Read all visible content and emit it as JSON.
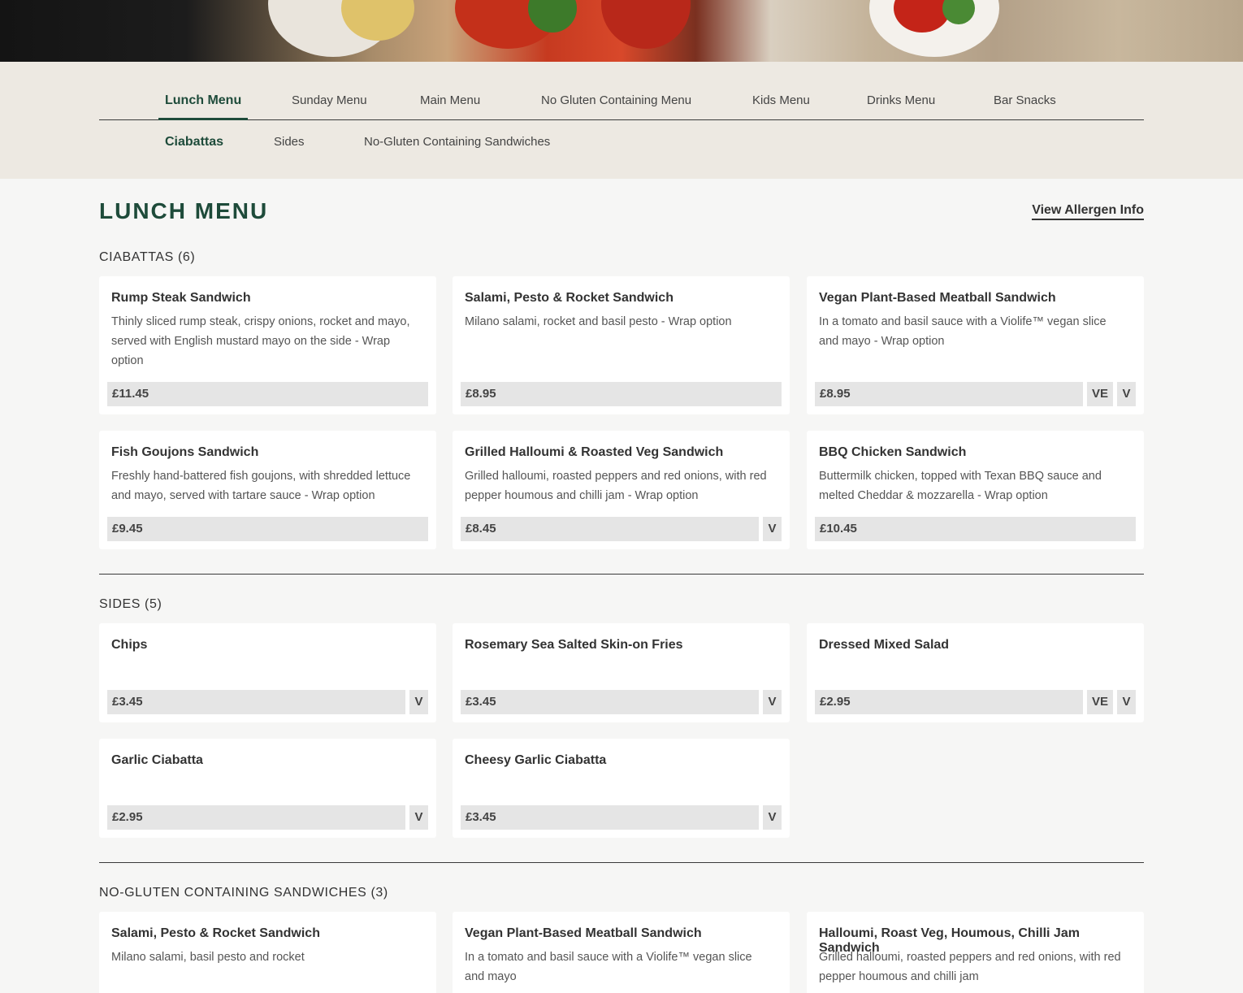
{
  "nav": {
    "tabs": [
      "Lunch Menu",
      "Sunday Menu",
      "Main Menu",
      "No Gluten Containing Menu",
      "Kids Menu",
      "Drinks Menu",
      "Bar Snacks"
    ],
    "subtabs": [
      "Ciabattas",
      "Sides",
      "No-Gluten Containing Sandwiches"
    ]
  },
  "page": {
    "title": "LUNCH MENU",
    "allergen_link": "View Allergen Info"
  },
  "colors": {
    "brand": "#1e4b3a",
    "price_bg": "#e5e5e5",
    "band_bg": "#ede9e2"
  },
  "sections": [
    {
      "title": "CIABATTAS (6)",
      "items": [
        {
          "name": "Rump Steak Sandwich",
          "desc": "Thinly sliced rump steak, crispy onions, rocket and mayo, served with English mustard mayo on the side - Wrap option",
          "price": "£11.45",
          "badges": []
        },
        {
          "name": "Salami, Pesto & Rocket Sandwich",
          "desc": "Milano salami, rocket and basil pesto - Wrap option",
          "price": "£8.95",
          "badges": []
        },
        {
          "name": "Vegan Plant-Based Meatball Sandwich",
          "desc": "In a tomato and basil sauce with a Violife™ vegan slice and mayo - Wrap option",
          "price": "£8.95",
          "badges": [
            "VE",
            "V"
          ]
        },
        {
          "name": "Fish Goujons Sandwich",
          "desc": "Freshly hand-battered fish goujons, with shredded lettuce and mayo, served with tartare sauce - Wrap option",
          "price": "£9.45",
          "badges": []
        },
        {
          "name": "Grilled Halloumi & Roasted Veg Sandwich",
          "desc": "Grilled halloumi, roasted peppers and red onions, with red pepper houmous and chilli jam - Wrap option",
          "price": "£8.45",
          "badges": [
            "V"
          ]
        },
        {
          "name": "BBQ Chicken Sandwich",
          "desc": "Buttermilk chicken, topped with Texan BBQ sauce and melted Cheddar & mozzarella - Wrap option",
          "price": "£10.45",
          "badges": []
        }
      ]
    },
    {
      "title": "SIDES (5)",
      "items": [
        {
          "name": "Chips",
          "desc": "",
          "price": "£3.45",
          "badges": [
            "V"
          ]
        },
        {
          "name": "Rosemary Sea Salted Skin-on Fries",
          "desc": "",
          "price": "£3.45",
          "badges": [
            "V"
          ]
        },
        {
          "name": "Dressed Mixed Salad",
          "desc": "",
          "price": "£2.95",
          "badges": [
            "VE",
            "V"
          ]
        },
        {
          "name": "Garlic Ciabatta",
          "desc": "",
          "price": "£2.95",
          "badges": [
            "V"
          ]
        },
        {
          "name": "Cheesy Garlic Ciabatta",
          "desc": "",
          "price": "£3.45",
          "badges": [
            "V"
          ]
        }
      ]
    },
    {
      "title": "NO-GLUTEN CONTAINING SANDWICHES (3)",
      "items": [
        {
          "name": "Salami, Pesto & Rocket Sandwich",
          "desc": "Milano salami, basil pesto and rocket",
          "price": "",
          "badges": []
        },
        {
          "name": "Vegan Plant-Based Meatball Sandwich",
          "desc": "In a tomato and basil sauce with a Violife™ vegan slice and mayo",
          "price": "",
          "badges": []
        },
        {
          "name": "Halloumi, Roast Veg, Houmous, Chilli Jam Sandwich",
          "desc": "Grilled halloumi, roasted peppers and red onions, with red pepper houmous and chilli jam",
          "price": "",
          "badges": []
        }
      ]
    }
  ]
}
